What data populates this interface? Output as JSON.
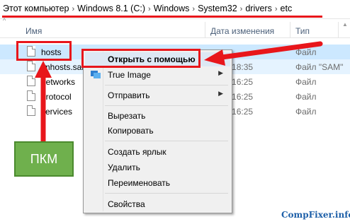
{
  "breadcrumb": {
    "items": [
      "Этот компьютер",
      "Windows 8.1 (C:)",
      "Windows",
      "System32",
      "drivers",
      "etc"
    ],
    "separator": "›"
  },
  "columns": {
    "name": "Имя",
    "date": "Дата изменения",
    "type": "Тип"
  },
  "files": [
    {
      "name": "hosts",
      "date": "",
      "type": "Файл"
    },
    {
      "name": "lmhosts.sam",
      "date": "2013 18:35",
      "type": "Файл \"SAM\""
    },
    {
      "name": "networks",
      "date": "2013 16:25",
      "type": "Файл"
    },
    {
      "name": "protocol",
      "date": "2013 16:25",
      "type": "Файл"
    },
    {
      "name": "services",
      "date": "2013 16:25",
      "type": "Файл"
    }
  ],
  "context_menu": {
    "items": [
      {
        "label": "Открыть с помощью",
        "bold": true
      },
      {
        "label": "True Image",
        "submenu": true
      },
      {
        "label": "Отправить",
        "submenu": true
      },
      {
        "label": "Вырезать"
      },
      {
        "label": "Копировать"
      },
      {
        "label": "Создать ярлык"
      },
      {
        "label": "Удалить"
      },
      {
        "label": "Переименовать"
      },
      {
        "label": "Свойства"
      }
    ]
  },
  "annotation": {
    "label": "ПКМ",
    "accent_color": "#e8161b",
    "box_color": "#6fb04d"
  },
  "watermark": "CompFixer.info"
}
